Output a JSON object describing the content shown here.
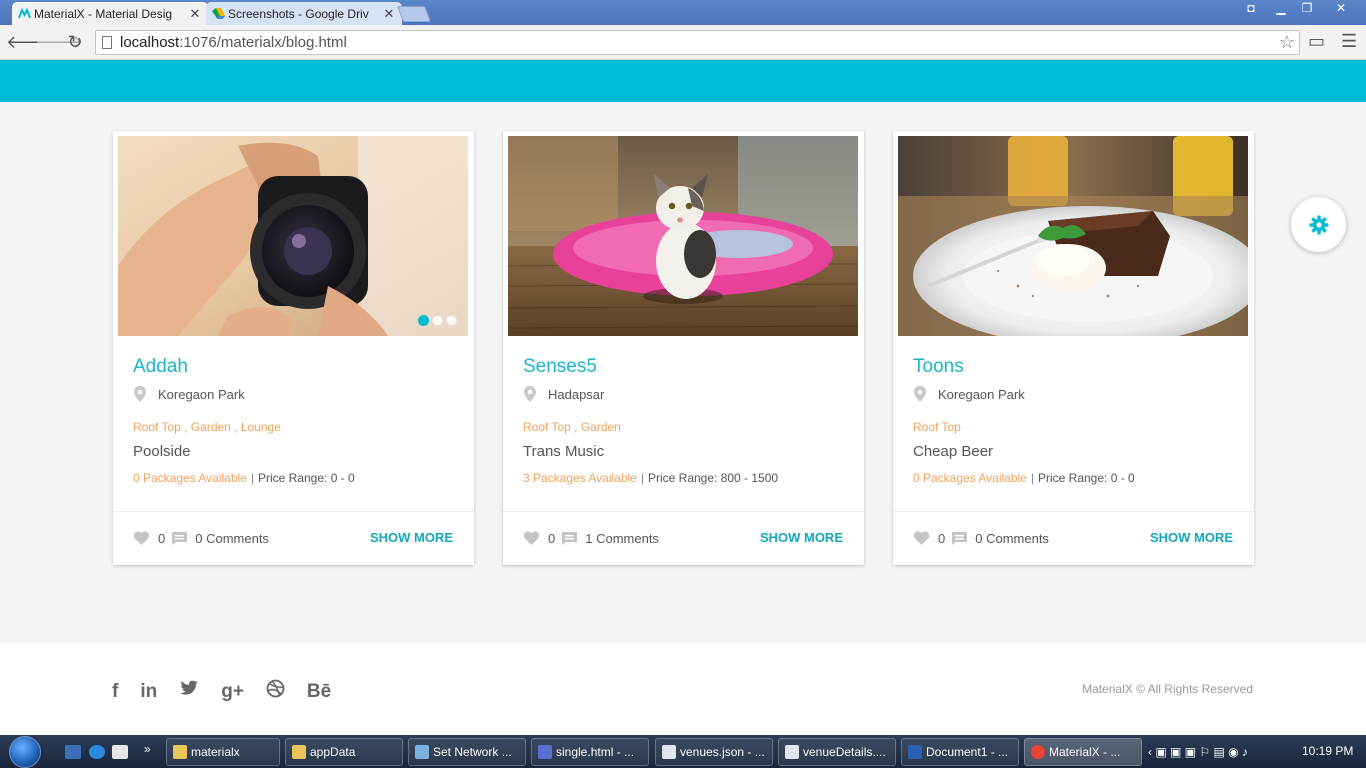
{
  "browser": {
    "tabs": [
      {
        "title": "MaterialX - Material Desig",
        "active": true
      },
      {
        "title": "Screenshots - Google Driv",
        "active": false
      }
    ],
    "url_host": "localhost",
    "url_rest": ":1076/materialx/blog.html"
  },
  "colors": {
    "accent": "#00bcd4",
    "tag": "#f0a35c",
    "title": "#1bb6c9"
  },
  "cards": [
    {
      "title": "Addah",
      "location": "Koregaon Park",
      "tags": "Roof Top , Garden , Lounge",
      "subtitle": "Poolside",
      "packages": "0 Packages Available",
      "price": "Price Range: 0 - 0",
      "likes": "0",
      "comments": "0 Comments",
      "action": "SHOW MORE",
      "image": "camera-photo"
    },
    {
      "title": "Senses5",
      "location": "Hadapsar",
      "tags": "Roof Top , Garden",
      "subtitle": "Trans Music",
      "packages": "3 Packages Available",
      "price": "Price Range: 800 - 1500",
      "likes": "0",
      "comments": "1 Comments",
      "action": "SHOW MORE",
      "image": "kitten-photo"
    },
    {
      "title": "Toons",
      "location": "Koregaon Park",
      "tags": "Roof Top",
      "subtitle": "Cheap Beer",
      "packages": "0 Packages Available",
      "price": "Price Range: 0 - 0",
      "likes": "0",
      "comments": "0 Comments",
      "action": "SHOW MORE",
      "image": "cake-photo"
    }
  ],
  "footer": {
    "social": [
      "f",
      "in",
      "t",
      "g+",
      "dribbble",
      "Bē"
    ],
    "copyright": "MaterialX © All Rights Reserved"
  },
  "taskbar": {
    "items": [
      "materialx",
      "appData",
      "Set Network ...",
      "single.html - ...",
      "venues.json - ...",
      "venueDetails....",
      "Document1 - ...",
      "MaterialX - ..."
    ],
    "clock": "10:19 PM"
  }
}
